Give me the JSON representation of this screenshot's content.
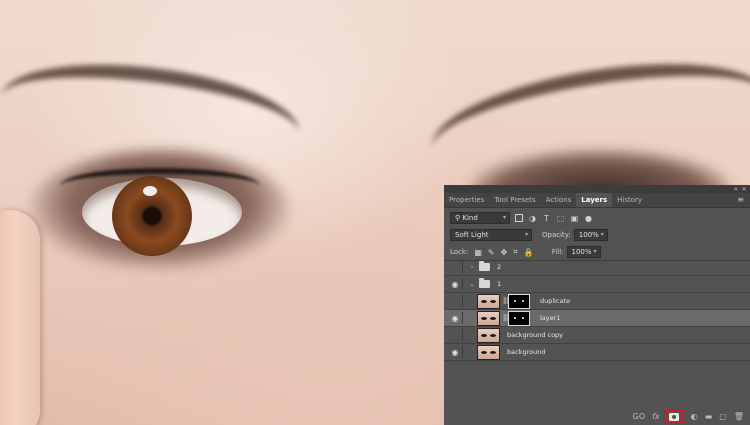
{
  "panel": {
    "tabs": [
      "Properties",
      "Tool Presets",
      "Actions",
      "Layers",
      "History"
    ],
    "active_tab": "Layers",
    "collapse_glyph": "«",
    "close_glyph": "×",
    "menu_glyph": "≡",
    "filter": {
      "kind_label": "Kind",
      "search_glyph": "⚲"
    },
    "blend_mode": "Soft Light",
    "opacity_label": "Opacity:",
    "opacity_value": "100%",
    "lock_label": "Lock:",
    "fill_label": "Fill:",
    "fill_value": "100%",
    "layers": [
      {
        "name": "2",
        "type": "group",
        "visible": false,
        "expanded": false,
        "selected": false
      },
      {
        "name": "1",
        "type": "group",
        "visible": true,
        "expanded": true,
        "selected": false
      },
      {
        "name": "duplicate",
        "type": "layer",
        "visible": false,
        "has_mask": true,
        "selected": false
      },
      {
        "name": "layer1",
        "type": "layer",
        "visible": true,
        "has_mask": true,
        "selected": true
      },
      {
        "name": "background copy",
        "type": "layer",
        "visible": false,
        "has_mask": false,
        "selected": false
      },
      {
        "name": "background",
        "type": "layer",
        "visible": true,
        "has_mask": false,
        "selected": false
      }
    ],
    "bottom_icons": [
      "link-icon",
      "fx-icon",
      "add-mask-icon",
      "adjustment-icon",
      "new-group-icon",
      "new-layer-icon",
      "trash-icon"
    ],
    "bottom_glyphs": {
      "link": "GO",
      "fx": "fx",
      "adjustment": "◐",
      "group": "▬",
      "newlayer": "▢",
      "trash": "🗑"
    },
    "highlight_color": "#c41e1e"
  }
}
